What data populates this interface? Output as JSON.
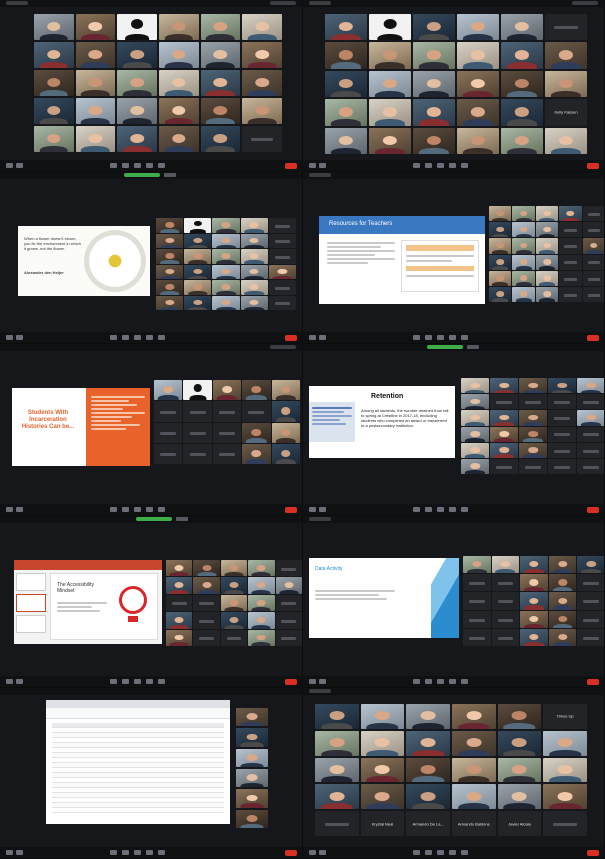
{
  "colors": {
    "background": "#1c1e22",
    "zoom_toolbar": "#101113",
    "share_green": "#3fae49",
    "end_button": "#d93025",
    "slide_orange": "#e8622a",
    "slide_blue": "#3b78c2",
    "slide_teal": "#2b8dcf",
    "bulb_red": "#d9262b"
  },
  "icons": [
    "microphone-icon",
    "camera-icon",
    "participants-icon",
    "chat-icon",
    "share-screen-icon",
    "record-icon",
    "reactions-icon",
    "end-meeting-icon",
    "lightbulb-icon",
    "flower-image"
  ],
  "shots": {
    "s1": {
      "names": []
    },
    "s2": {
      "names": [
        "Kelly Kassen"
      ]
    },
    "s3": {
      "slide_quote": "When a flower doesn't bloom, you fix the environment in which it grows, not the flower.",
      "slide_author": "Alexander den Heijer"
    },
    "s4": {
      "slide_title": "Resources for Teachers"
    },
    "s5": {
      "slide_title": "Students With Incarceration Histories Can be..."
    },
    "s6": {
      "slide_title": "Retention",
      "slide_body": "Among all students, the number retained from fall to spring at Crestline in 2017-18, excluding students who completed an award or transferred to a postsecondary institution."
    },
    "s7": {
      "slide_title": "The Accessibility Mindset"
    },
    "s8": {
      "slide_title": "Data Activity"
    },
    "s9": {},
    "s10": {
      "names": [
        "Times Up",
        "Krystal Neal",
        "Armando De La...",
        "Armando Baldone",
        "Javier Alcala"
      ]
    }
  }
}
